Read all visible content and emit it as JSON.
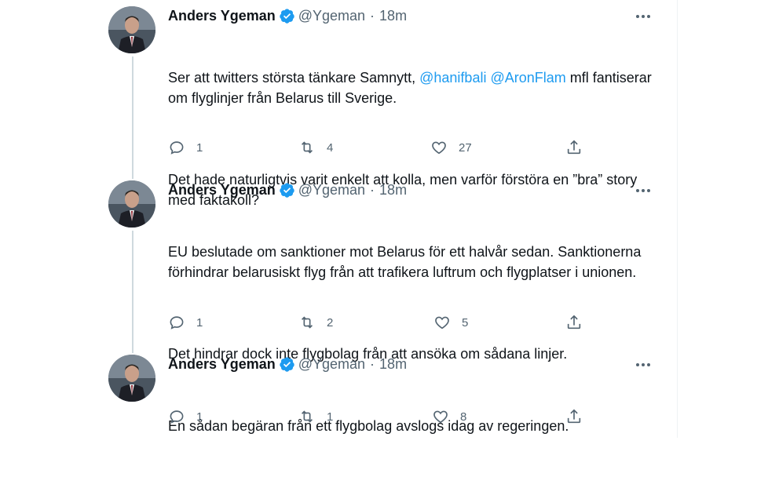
{
  "colors": {
    "accent": "#1d9bf0",
    "secondary_text": "#536471",
    "thread_line": "#cfd9de"
  },
  "tweets": [
    {
      "name": "Anders Ygeman",
      "handle": "@Ygeman",
      "separator": "·",
      "time": "18m",
      "text_before": "Ser att twitters största tänkare Samnytt, ",
      "mention1": "@hanifbali",
      "text_between": " ",
      "mention2": "@AronFlam",
      "text_after": " mfl fantiserar om flyglinjer från Belarus till Sverige.",
      "para2": "Det hade naturligtvis varit enkelt att kolla, men varför förstöra en ”bra” story med faktakoll?",
      "replies": "1",
      "retweets": "4",
      "likes": "27"
    },
    {
      "name": "Anders Ygeman",
      "handle": "@Ygeman",
      "separator": "·",
      "time": "18m",
      "para1": "EU beslutade om sanktioner mot Belarus för ett halvår sedan. Sanktionerna förhindrar belarusiskt flyg från att trafikera luftrum och flygplatser i unionen.",
      "para2": "Det hindrar dock inte flygbolag från att ansöka om sådana linjer.",
      "replies": "1",
      "retweets": "2",
      "likes": "5"
    },
    {
      "name": "Anders Ygeman",
      "handle": "@Ygeman",
      "separator": "·",
      "time": "18m",
      "para1": "En sådan begäran från ett flygbolag avslogs idag av regeringen.",
      "replies": "1",
      "retweets": "1",
      "likes": "8"
    }
  ],
  "icons": {
    "verified": "verified-badge-icon",
    "more": "more-icon",
    "reply": "reply-icon",
    "retweet": "retweet-icon",
    "like": "heart-icon",
    "share": "share-icon"
  }
}
